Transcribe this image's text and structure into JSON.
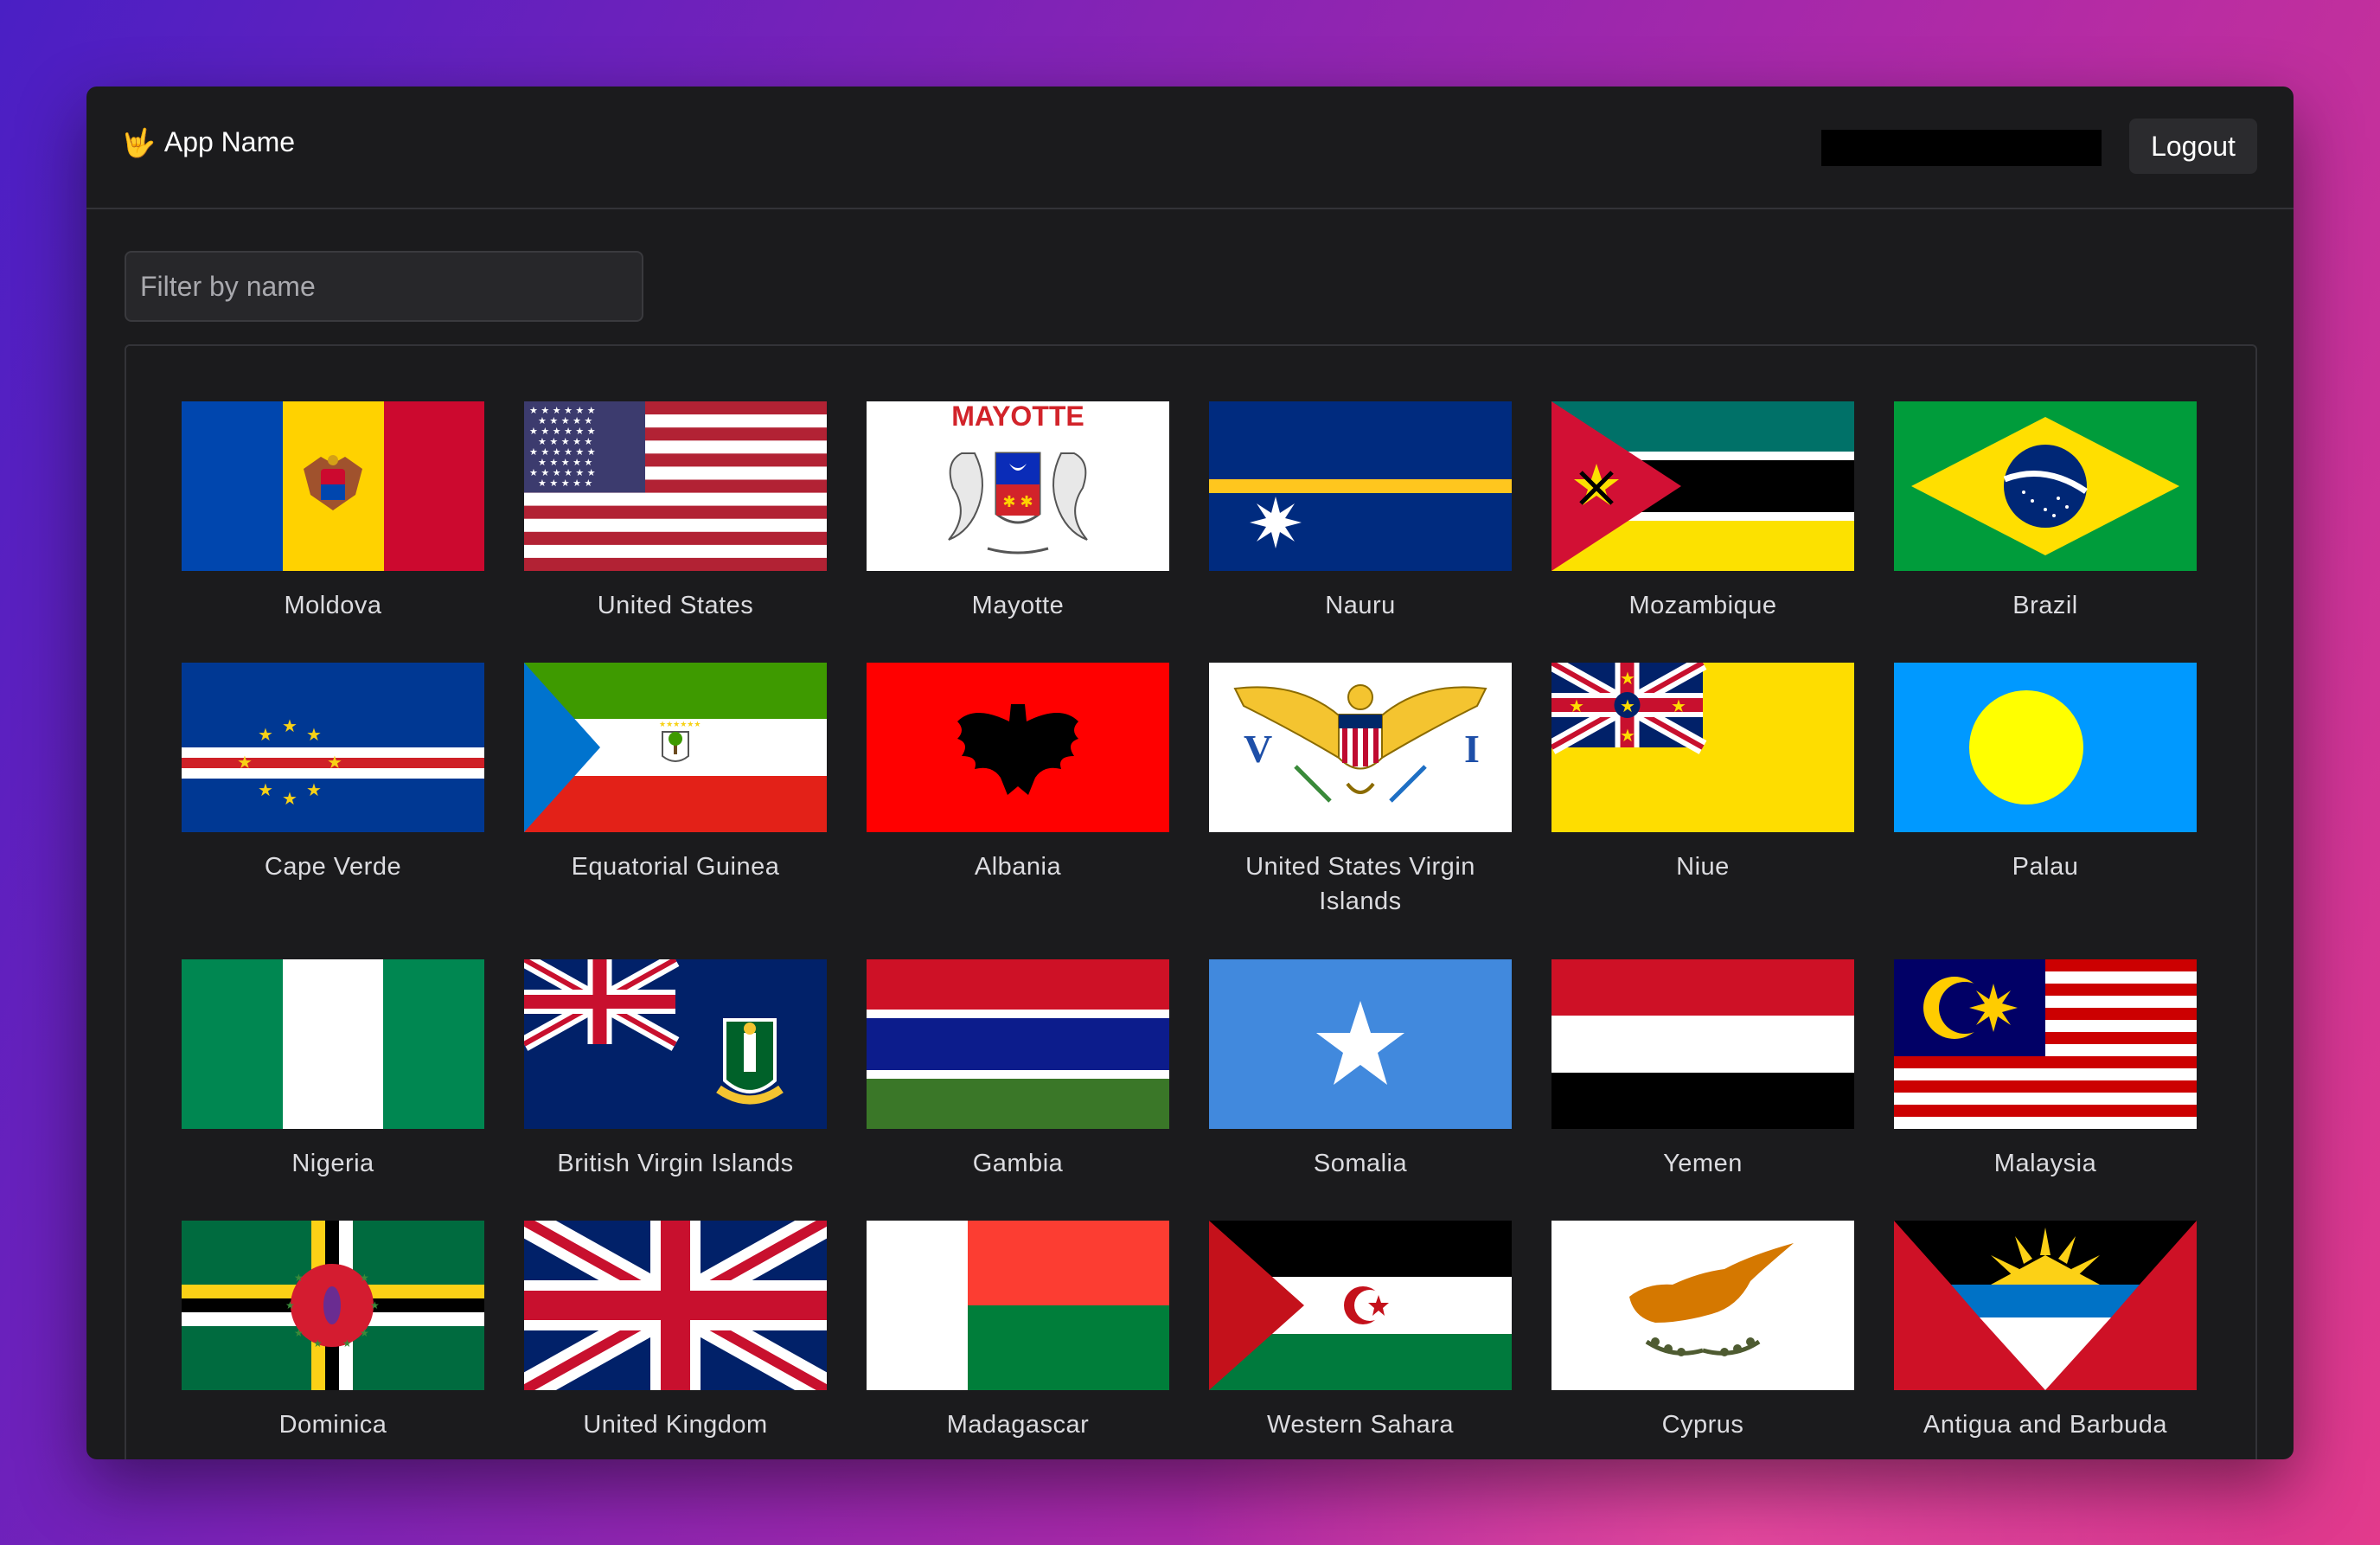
{
  "header": {
    "brand_icon": "🤟",
    "app_name": "App Name",
    "logout_label": "Logout"
  },
  "filter": {
    "placeholder": "Filter by name",
    "value": ""
  },
  "countries": [
    "Moldova",
    "United States",
    "Mayotte",
    "Nauru",
    "Mozambique",
    "Brazil",
    "Cape Verde",
    "Equatorial Guinea",
    "Albania",
    "United States Virgin Islands",
    "Niue",
    "Palau",
    "Nigeria",
    "British Virgin Islands",
    "Gambia",
    "Somalia",
    "Yemen",
    "Malaysia",
    "Dominica",
    "United Kingdom",
    "Madagascar",
    "Western Sahara",
    "Cyprus",
    "Antigua and Barbuda"
  ],
  "flag_texts": {
    "mayotte_banner": "MAYOTTE",
    "usvi_left": "V",
    "usvi_right": "I"
  }
}
